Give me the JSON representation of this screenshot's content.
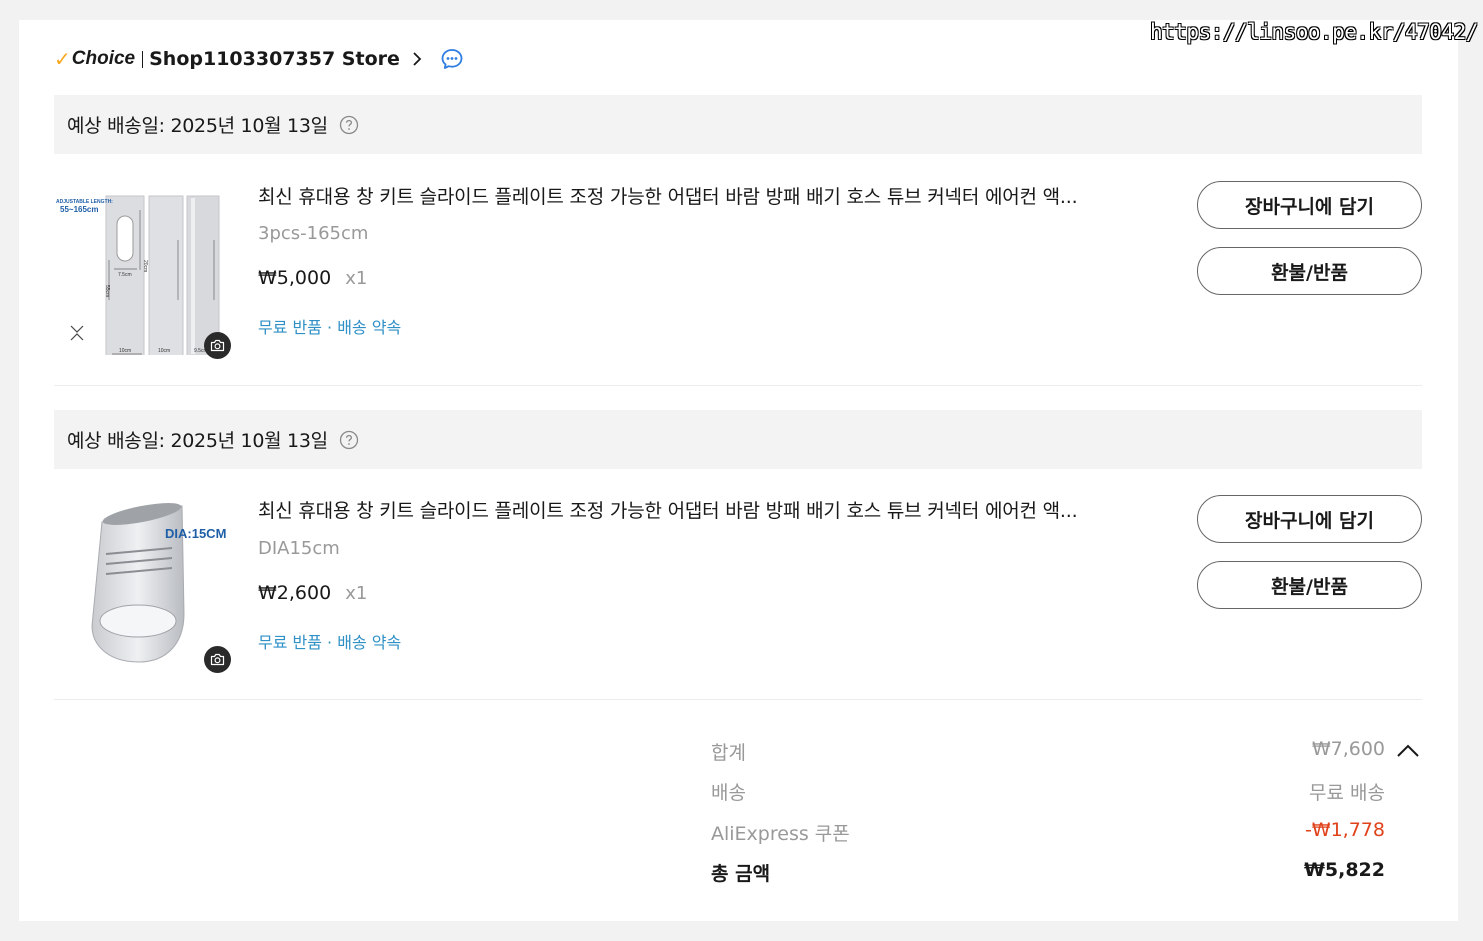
{
  "watermark": "https://linsoo.pe.kr/47042/",
  "store": {
    "check_mark": "✓",
    "choice_label": "Choice",
    "name": "Shop1103307357 Store"
  },
  "orders": [
    {
      "delivery_text": "예상 배송일: 2025년 10월 13일",
      "title": "최신 휴대용 창 키트 슬라이드 플레이트 조정 가능한 어댑터 바람 방패 배기 호스 튜브 커넥터 에어컨 액...",
      "variant": "3pcs-165cm",
      "price": "₩5,000",
      "qty": "x1",
      "promise": "무료 반품 · 배송 약속",
      "image_text": {
        "adjustable": "ADJUSTABLE LENGTH:",
        "length": "55~165cm",
        "dim_20": "20cm",
        "dim_55": "55cm",
        "dim_75": "7.5cm",
        "dim_10": "10cm",
        "dim_95": "9.5cm"
      },
      "add_to_cart": "장바구니에 담기",
      "refund": "환불/반품"
    },
    {
      "delivery_text": "예상 배송일: 2025년 10월 13일",
      "title": "최신 휴대용 창 키트 슬라이드 플레이트 조정 가능한 어댑터 바람 방패 배기 호스 튜브 커넥터 에어컨 액...",
      "variant": "DIA15cm",
      "price": "₩2,600",
      "qty": "x1",
      "promise": "무료 반품 · 배송 약속",
      "image_text": {
        "dia": "DIA:15CM"
      },
      "add_to_cart": "장바구니에 담기",
      "refund": "환불/반품"
    }
  ],
  "summary": {
    "subtotal_label": "합계",
    "subtotal_value": "₩7,600",
    "shipping_label": "배송",
    "shipping_value": "무료 배송",
    "coupon_label": "AliExpress 쿠폰",
    "coupon_value": "-₩1,778",
    "total_label": "총 금액",
    "total_value": "₩5,822"
  },
  "colors": {
    "choice_check": "#f7a823",
    "link_blue": "#2f90c6",
    "discount_red": "#e0421b",
    "chat_icon_blue": "#2f7de1"
  }
}
